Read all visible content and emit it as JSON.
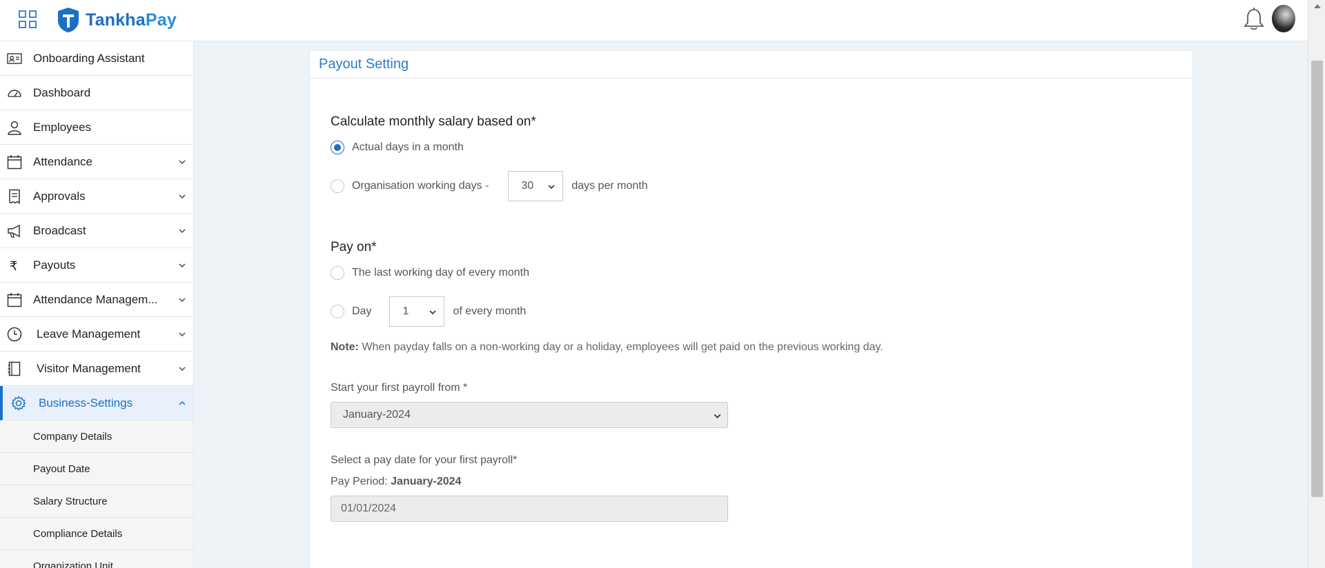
{
  "header": {
    "logo_text_main": "Tankha",
    "logo_text_accent": "Pay",
    "icons": [
      "apps-grid-icon",
      "bell-icon",
      "user-avatar"
    ]
  },
  "sidebar": {
    "items": [
      {
        "label": "Onboarding Assistant",
        "icon": "id-card-icon",
        "expandable": false
      },
      {
        "label": "Dashboard",
        "icon": "speedometer-icon",
        "expandable": false
      },
      {
        "label": "Employees",
        "icon": "person-icon",
        "expandable": false
      },
      {
        "label": "Attendance",
        "icon": "calendar-icon",
        "expandable": true
      },
      {
        "label": "Approvals",
        "icon": "document-icon",
        "expandable": true
      },
      {
        "label": "Broadcast",
        "icon": "megaphone-icon",
        "expandable": true
      },
      {
        "label": "Payouts",
        "icon": "rupee-icon",
        "expandable": true
      },
      {
        "label": "Attendance Managem...",
        "icon": "calendar-icon",
        "expandable": true
      },
      {
        "label": "Leave Management",
        "icon": "clock-icon",
        "expandable": true
      },
      {
        "label": "Visitor Management",
        "icon": "notebook-icon",
        "expandable": true
      },
      {
        "label": "Business-Settings",
        "icon": "gear-icon",
        "expandable": true,
        "active": true
      }
    ],
    "sub_items": [
      {
        "label": "Company Details"
      },
      {
        "label": "Payout Date"
      },
      {
        "label": "Salary Structure"
      },
      {
        "label": "Compliance Details"
      },
      {
        "label": "Organization Unit"
      }
    ]
  },
  "main": {
    "card_title": "Payout Setting",
    "salary_basis": {
      "heading": "Calculate monthly salary based on*",
      "option_actual": "Actual days in a month",
      "option_org": "Organisation working days -",
      "org_days_value": "30",
      "org_days_suffix": "days per month",
      "selected": "actual"
    },
    "pay_on": {
      "heading": "Pay on*",
      "option_last": "The last working day of every month",
      "option_day": "Day",
      "day_value": "1",
      "day_suffix": "of every month"
    },
    "note": {
      "label": "Note:",
      "text": " When payday falls on a non-working day or a holiday, employees will get paid on the previous working day."
    },
    "first_payroll": {
      "label": "Start your first payroll from *",
      "value": "January-2024"
    },
    "pay_date": {
      "label": "Select a pay date for your first payroll*",
      "period_label": "Pay Period: ",
      "period_value": "January-2024",
      "date_value": "01/01/2024"
    }
  },
  "colors": {
    "accent": "#1b6fc7",
    "active_bg": "#e8f1fb",
    "page_bg": "#eef3f8"
  }
}
